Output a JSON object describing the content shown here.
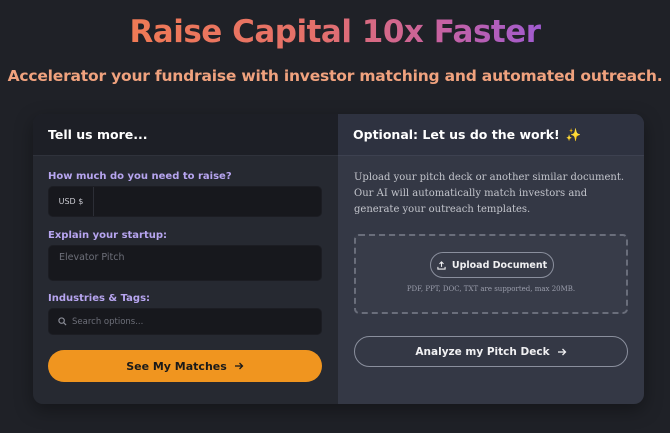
{
  "hero": {
    "title": "Raise Capital 10x Faster",
    "subtitle": "Accelerator your fundraise with investor matching and automated outreach."
  },
  "form": {
    "heading": "Tell us more...",
    "raise_label": "How much do you need to raise?",
    "currency_prefix": "USD $",
    "raise_value": "",
    "explain_label": "Explain your startup:",
    "explain_placeholder": "Elevator Pitch",
    "tags_label": "Industries & Tags:",
    "tags_placeholder": "Search options...",
    "submit_label": "See My Matches"
  },
  "upload": {
    "heading": "Optional: Let us do the work!",
    "heading_emoji": "✨",
    "description": "Upload your pitch deck or another similar document. Our AI will automatically match investors and generate your outreach templates.",
    "upload_button_label": "Upload Document",
    "supported_note": "PDF, PPT, DOC, TXT are supported, max 20MB.",
    "analyze_button_label": "Analyze my Pitch Deck"
  },
  "icons": {
    "search": "search-icon",
    "upload": "upload-icon",
    "arrow": "arrow-right-icon",
    "sparkle": "sparkle-icon"
  },
  "colors": {
    "accent_orange": "#f0951f",
    "label_purple": "#b7a5f0",
    "subtitle_peach": "#f0a27e"
  }
}
